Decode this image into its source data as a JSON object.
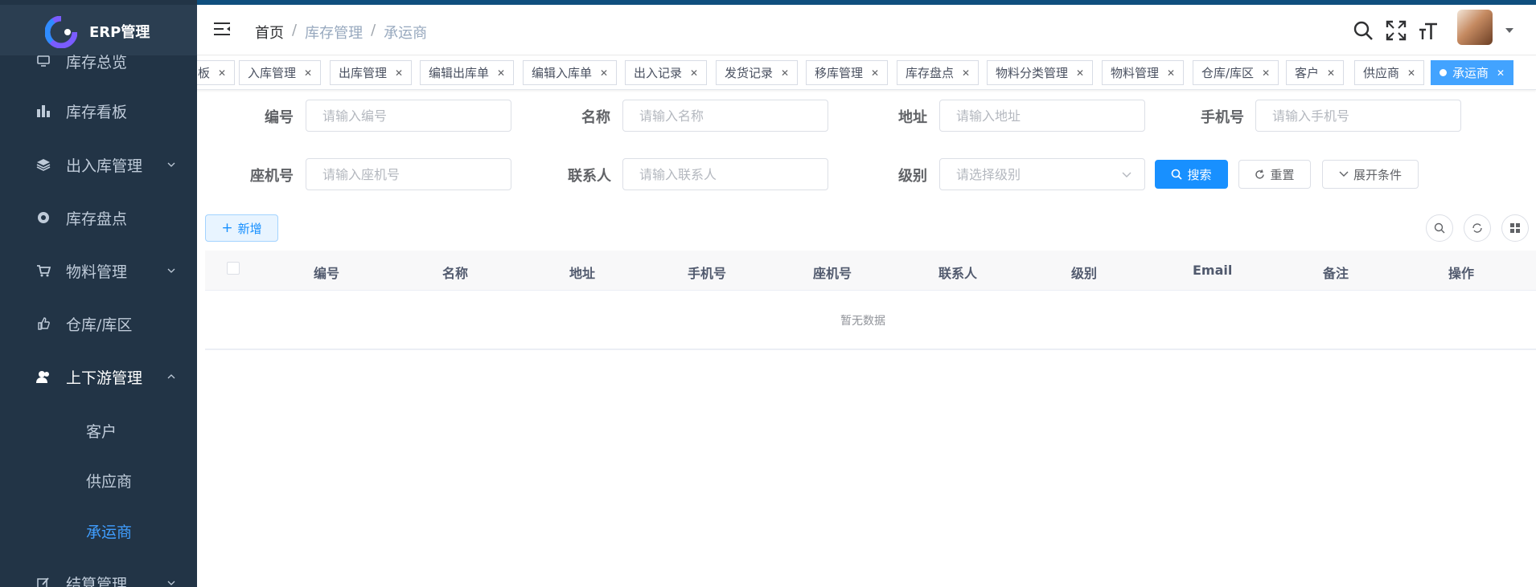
{
  "app": {
    "title": "ERP管理"
  },
  "colors": {
    "sidebar_bg": "#223446",
    "accent": "#1890ff",
    "active_menu": "#409eff",
    "active_tag": "#42a3ff"
  },
  "sidebar": {
    "items": [
      {
        "label": "库存总览",
        "icon": "monitor-icon"
      },
      {
        "label": "库存看板",
        "icon": "bar-chart-icon"
      },
      {
        "label": "出入库管理",
        "icon": "layers-icon"
      },
      {
        "label": "库存盘点",
        "icon": "target-icon"
      },
      {
        "label": "物料管理",
        "icon": "cart-icon"
      },
      {
        "label": "仓库/库区",
        "icon": "thumb-icon"
      },
      {
        "label": "上下游管理",
        "icon": "user-icon"
      },
      {
        "label": "客户"
      },
      {
        "label": "供应商"
      },
      {
        "label": "承运商"
      },
      {
        "label": "结算管理",
        "icon": "edit-icon"
      }
    ]
  },
  "header": {
    "breadcrumb": {
      "home": "首页",
      "sep": "/",
      "level1": "库存管理",
      "level2": "承运商"
    }
  },
  "tags": [
    {
      "label": "板"
    },
    {
      "label": "入库管理"
    },
    {
      "label": "出库管理"
    },
    {
      "label": "编辑出库单"
    },
    {
      "label": "编辑入库单"
    },
    {
      "label": "出入记录"
    },
    {
      "label": "发货记录"
    },
    {
      "label": "移库管理"
    },
    {
      "label": "库存盘点"
    },
    {
      "label": "物料分类管理"
    },
    {
      "label": "物料管理"
    },
    {
      "label": "仓库/库区"
    },
    {
      "label": "客户"
    },
    {
      "label": "供应商"
    },
    {
      "label": "承运商",
      "active": true
    }
  ],
  "search": {
    "code": {
      "label": "编号",
      "placeholder": "请输入编号"
    },
    "name": {
      "label": "名称",
      "placeholder": "请输入名称"
    },
    "address": {
      "label": "地址",
      "placeholder": "请输入地址"
    },
    "mobile": {
      "label": "手机号",
      "placeholder": "请输入手机号"
    },
    "phone": {
      "label": "座机号",
      "placeholder": "请输入座机号"
    },
    "contact": {
      "label": "联系人",
      "placeholder": "请输入联系人"
    },
    "level": {
      "label": "级别",
      "placeholder": "请选择级别"
    },
    "search_btn": "搜索",
    "reset_btn": "重置",
    "expand_btn": "展开条件"
  },
  "toolbar": {
    "add_btn": "新增"
  },
  "table": {
    "columns": [
      "编号",
      "名称",
      "地址",
      "手机号",
      "座机号",
      "联系人",
      "级别",
      "Email",
      "备注",
      "操作"
    ],
    "rows": [],
    "empty_text": "暂无数据"
  }
}
